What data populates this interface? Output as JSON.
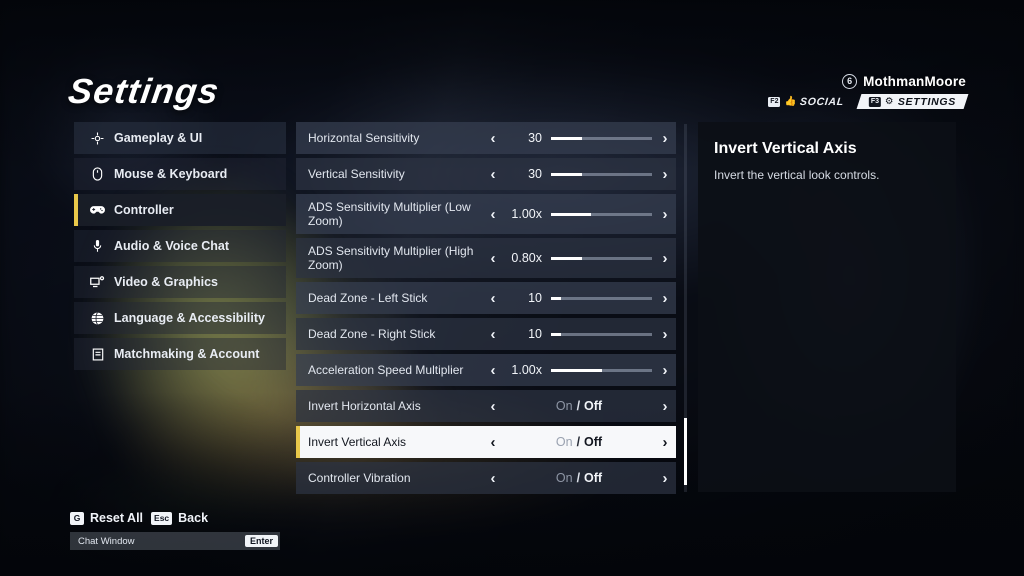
{
  "page_title": "Settings",
  "player": {
    "level": "6",
    "name": "MothmanMoore",
    "tabs": [
      {
        "key": "F2",
        "label": "SOCIAL",
        "icon": "social-icon",
        "active": false
      },
      {
        "key": "F3",
        "label": "SETTINGS",
        "icon": "gear-icon",
        "active": true
      }
    ]
  },
  "sidebar": {
    "items": [
      {
        "label": "Gameplay & UI",
        "icon": "crosshair-icon"
      },
      {
        "label": "Mouse & Keyboard",
        "icon": "mouse-icon"
      },
      {
        "label": "Controller",
        "icon": "gamepad-icon"
      },
      {
        "label": "Audio & Voice Chat",
        "icon": "microphone-icon"
      },
      {
        "label": "Video & Graphics",
        "icon": "monitor-icon"
      },
      {
        "label": "Language & Accessibility",
        "icon": "globe-icon"
      },
      {
        "label": "Matchmaking & Account",
        "icon": "document-icon"
      }
    ],
    "selected_index": 2
  },
  "settings": {
    "rows": [
      {
        "label": "Horizontal Sensitivity",
        "type": "slider",
        "value": "30",
        "fill_pct": 31
      },
      {
        "label": "Vertical Sensitivity",
        "type": "slider",
        "value": "30",
        "fill_pct": 31
      },
      {
        "label": "ADS Sensitivity Multiplier (Low Zoom)",
        "type": "slider",
        "value": "1.00x",
        "fill_pct": 40,
        "tall": true
      },
      {
        "label": "ADS Sensitivity Multiplier (High Zoom)",
        "type": "slider",
        "value": "0.80x",
        "fill_pct": 31,
        "tall": true
      },
      {
        "label": "Dead Zone - Left Stick",
        "type": "slider",
        "value": "10",
        "fill_pct": 10
      },
      {
        "label": "Dead Zone - Right Stick",
        "type": "slider",
        "value": "10",
        "fill_pct": 10
      },
      {
        "label": "Acceleration Speed Multiplier",
        "type": "slider",
        "value": "1.00x",
        "fill_pct": 50
      },
      {
        "label": "Invert Horizontal Axis",
        "type": "toggle",
        "option_on": "On",
        "separator": "/",
        "option_off": "Off",
        "selected_option": "Off"
      },
      {
        "label": "Invert Vertical Axis",
        "type": "toggle",
        "option_on": "On",
        "separator": "/",
        "option_off": "Off",
        "selected_option": "Off"
      },
      {
        "label": "Controller Vibration",
        "type": "toggle",
        "option_on": "On",
        "separator": "/",
        "option_off": "Off",
        "selected_option": "Off"
      }
    ],
    "selected_index": 8,
    "scroll": {
      "thumb_top_pct": 80,
      "thumb_height_pct": 18
    }
  },
  "description": {
    "title": "Invert Vertical Axis",
    "body": "Invert the vertical look controls."
  },
  "footer": {
    "hints": [
      {
        "key": "G",
        "label": "Reset All"
      },
      {
        "key": "Esc",
        "label": "Back"
      }
    ],
    "chat_placeholder": "Chat Window",
    "chat_key": "Enter"
  },
  "colors": {
    "accent": "#e9c84a",
    "selected_row_bg": "#f7f8fa",
    "text_primary": "#ffffff",
    "panel_bg": "#0c0f16"
  }
}
